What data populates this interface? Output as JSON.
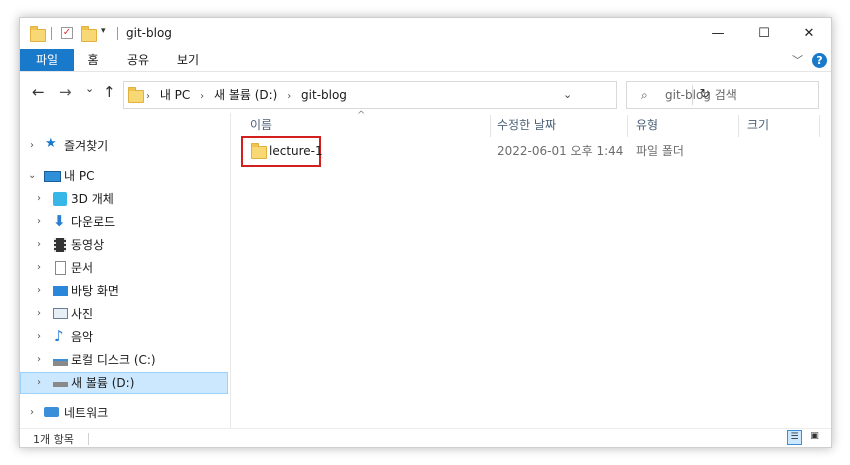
{
  "window": {
    "title": "git-blog"
  },
  "quick_access": {
    "folder_icon": "folder-icon",
    "properties_icon": "properties-check-icon",
    "newfolder_icon": "new-folder-icon",
    "customize_icon": "customize-dropdown-icon"
  },
  "window_controls": {
    "minimize": "—",
    "maximize": "☐",
    "close": "✕"
  },
  "ribbon": {
    "tabs": [
      {
        "label": "파일"
      },
      {
        "label": "홈"
      },
      {
        "label": "공유"
      },
      {
        "label": "보기"
      }
    ],
    "expand": "﹀",
    "help": "?"
  },
  "nav": {
    "back": "←",
    "forward": "→",
    "recent": "⌄",
    "up": "↑"
  },
  "address": {
    "crumbs": [
      "내 PC",
      "새 볼륨 (D:)",
      "git-blog"
    ],
    "separator": "›",
    "dropdown": "⌄",
    "refresh": "↻"
  },
  "search": {
    "placeholder": "git-blog 검색",
    "icon": "⌕"
  },
  "sidebar": {
    "items": [
      {
        "label": "즐겨찾기",
        "icon": "star-icon"
      },
      {
        "label": "내 PC",
        "icon": "pc-icon"
      },
      {
        "label": "3D 개체",
        "icon": "3d-objects-icon"
      },
      {
        "label": "다운로드",
        "icon": "download-icon"
      },
      {
        "label": "동영상",
        "icon": "video-icon"
      },
      {
        "label": "문서",
        "icon": "document-icon"
      },
      {
        "label": "바탕 화면",
        "icon": "desktop-icon"
      },
      {
        "label": "사진",
        "icon": "pictures-icon"
      },
      {
        "label": "음악",
        "icon": "music-icon"
      },
      {
        "label": "로컬 디스크 (C:)",
        "icon": "local-disk-icon"
      },
      {
        "label": "새 볼륨 (D:)",
        "icon": "drive-icon"
      },
      {
        "label": "네트워크",
        "icon": "network-icon"
      }
    ],
    "chevron_collapsed": "›",
    "chevron_expanded": "⌄"
  },
  "columns": {
    "name": "이름",
    "modified": "수정한 날짜",
    "type": "유형",
    "size": "크기",
    "sort_indicator": "^"
  },
  "files": [
    {
      "name": "lecture-1",
      "modified": "2022-06-01 오후 1:44",
      "type": "파일 폴더",
      "size": ""
    }
  ],
  "status": {
    "count": "1개 항목"
  },
  "colors": {
    "accent": "#1979ca",
    "selection_bg": "#cce8ff",
    "highlight_border": "#d41f1f"
  }
}
